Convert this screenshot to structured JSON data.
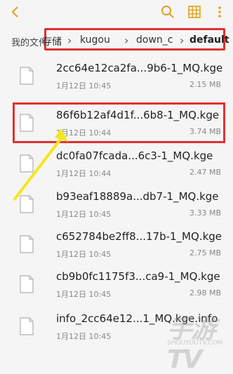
{
  "breadcrumb": {
    "root": "我的文件",
    "items": [
      "存储",
      "kugou",
      "down_c",
      "default"
    ]
  },
  "files": [
    {
      "name": "2cc64e12ca2fa...9b6-1_MQ.kge",
      "date": "1月12日 10:45",
      "size": "2.15 MB"
    },
    {
      "name": "86f6b12af4d1f...6b8-1_MQ.kge",
      "date": "1月12日 10:44",
      "size": "3.74 MB"
    },
    {
      "name": "dc0fa07fcada...6c3-1_MQ.kge",
      "date": "1月12日 10:44",
      "size": "2.47 MB"
    },
    {
      "name": "b93eaf18889a...db7-1_MQ.kge",
      "date": "1月12日 10:45",
      "size": "3.33 MB"
    },
    {
      "name": "c652784be2ff8...17b-1_MQ.kge",
      "date": "1月12日 10:45",
      "size": "2.75 MB"
    },
    {
      "name": "cb9b0fc1175f3...ca9-1_MQ.kge",
      "date": "1月12日 10:45",
      "size": "2.98 MB"
    },
    {
      "name": "info_2cc64e12...1_MQ.kge.info",
      "date": "1月12日 10:45",
      "size": ""
    }
  ],
  "watermark": {
    "text": "手游TV",
    "url": "SHOUYOUTV.COM"
  },
  "colors": {
    "accent": "#e0a020",
    "highlight": "#e23030",
    "arrow": "#f5e61e"
  },
  "icons": [
    "back-icon",
    "search-icon",
    "grid-view-icon",
    "more-icon",
    "file-icon",
    "chevron-right-icon"
  ]
}
